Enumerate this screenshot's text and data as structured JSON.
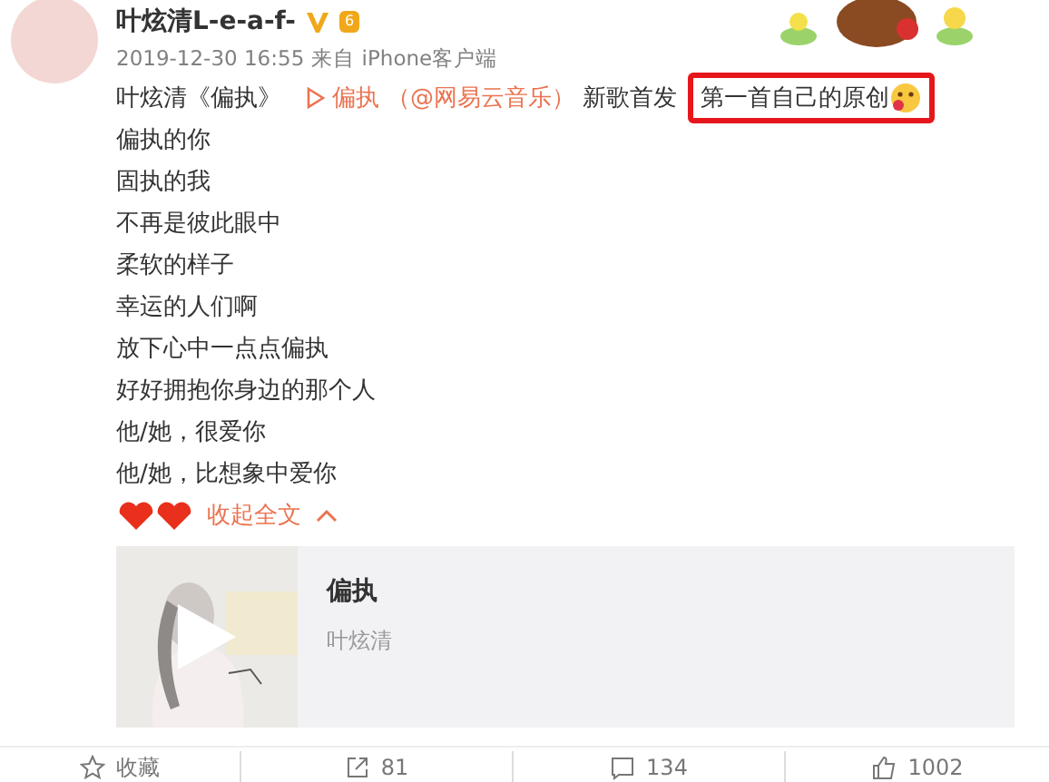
{
  "post": {
    "author": "叶炫清L-e-a-f-",
    "verified": true,
    "level_badge": "6",
    "time": "2019-12-30 16:55",
    "source": "来自 iPhone客户端",
    "lead": [
      {
        "kind": "text",
        "text": "叶炫清《偏执》"
      },
      {
        "kind": "music_link",
        "text": "偏执"
      },
      {
        "kind": "mention",
        "text": "（@网易云音乐）"
      },
      {
        "kind": "text",
        "text": "新歌首发"
      },
      {
        "kind": "highlight",
        "text": "第一首自己的原创"
      }
    ],
    "lines": [
      "偏执的你",
      "固执的我",
      "不再是彼此眼中",
      "柔软的样子",
      "幸运的人们啊",
      "放下心中一点点偏执",
      "好好拥抱你身边的那个人",
      "他/她，很爱你",
      "他/她，比想象中爱你"
    ],
    "collapse": {
      "label": "收起全文",
      "expanded": true
    },
    "card": {
      "title": "偏执",
      "artist": "叶炫清",
      "kind": "picture"
    },
    "actions": [
      {
        "kind": "favorite",
        "label": "收藏"
      },
      {
        "kind": "repost",
        "label": "81"
      },
      {
        "kind": "comment",
        "label": "134"
      },
      {
        "kind": "like",
        "label": "1002"
      }
    ]
  }
}
